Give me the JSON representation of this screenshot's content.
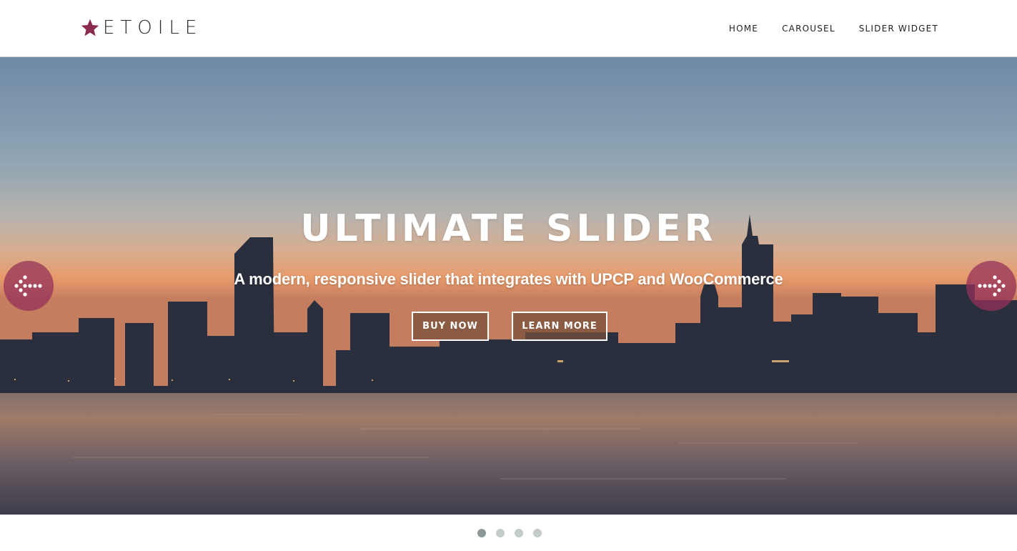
{
  "brand": {
    "name": "ETOILE",
    "star_color": "#8b2a4f"
  },
  "nav": {
    "items": [
      {
        "label": "HOME"
      },
      {
        "label": "CAROUSEL"
      },
      {
        "label": "SLIDER WIDGET"
      }
    ]
  },
  "hero": {
    "title": "ULTIMATE SLIDER",
    "subtitle": "A modern, responsive slider that integrates with UPCP and WooCommerce",
    "buttons": [
      {
        "label": "BUY NOW"
      },
      {
        "label": "LEARN MORE"
      }
    ],
    "arrow_color": "#96325a",
    "prev_icon": "arrow-left-icon",
    "next_icon": "arrow-right-icon"
  },
  "pagination": {
    "total": 4,
    "active_index": 0
  }
}
